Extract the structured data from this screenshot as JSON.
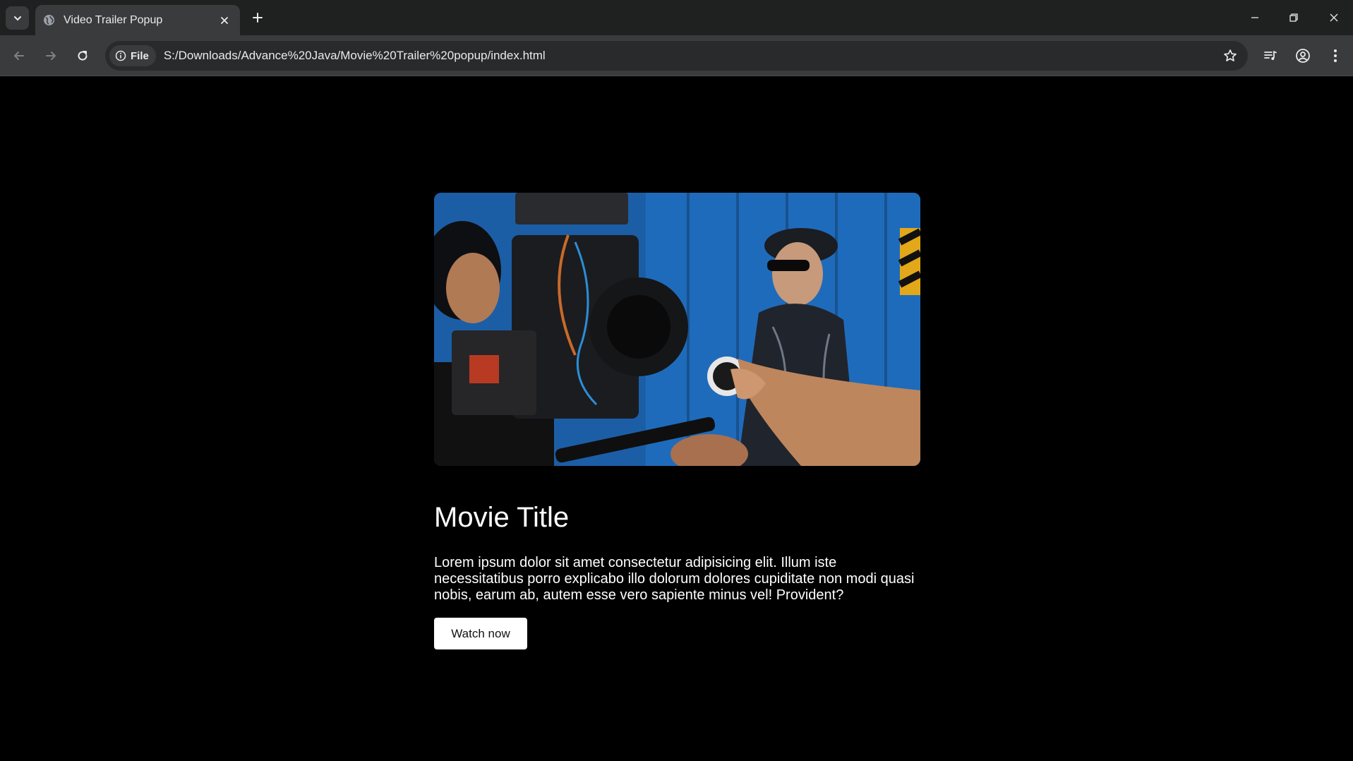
{
  "browser": {
    "tab_title": "Video Trailer Popup",
    "site_chip_label": "File",
    "url": "S:/Downloads/Advance%20Java/Movie%20Trailer%20popup/index.html",
    "icons": {
      "tab_search": "chevron-down-icon",
      "favicon": "globe-icon",
      "tab_close": "close-icon",
      "new_tab": "plus-icon",
      "back": "arrow-left-icon",
      "forward": "arrow-right-icon",
      "reload": "reload-icon",
      "site_info": "info-icon",
      "bookmark": "star-icon",
      "media": "media-control-icon",
      "profile": "profile-icon",
      "menu": "kebab-menu-icon",
      "minimize": "minimize-icon",
      "restore": "restore-icon",
      "close_window": "close-window-icon"
    },
    "colors": {
      "chrome_dark": "#1f2020",
      "chrome_toolbar": "#3a3b3d",
      "omnibox": "#282a2c",
      "text": "#e8eaed"
    }
  },
  "page": {
    "movie_title": "Movie Title",
    "description": "Lorem ipsum dolor sit amet consectetur adipisicing elit. Illum iste necessitatibus porro explicabo illo dolorum dolores cupiditate non modi quasi nobis, earum ab, autem esse vero sapiente minus vel! Provident?",
    "watch_button": "Watch now",
    "colors": {
      "background": "#000000",
      "text": "#ffffff",
      "button_bg": "#ffffff",
      "button_text": "#111111"
    }
  }
}
